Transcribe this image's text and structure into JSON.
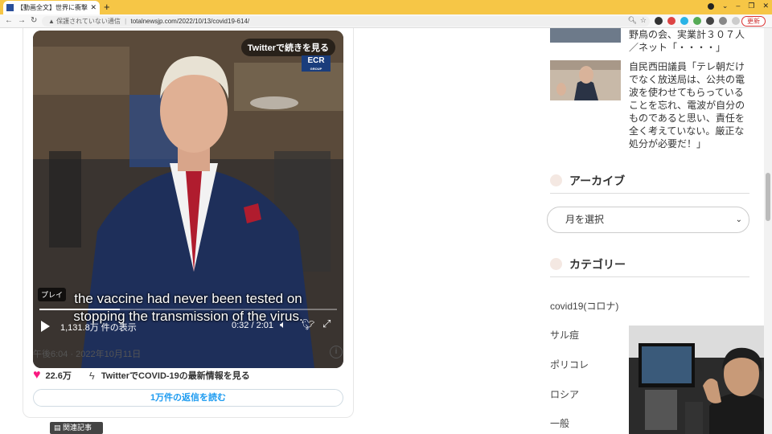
{
  "browser": {
    "tab_title": "【動画全文】世界に衝撃走る！／欧",
    "new_tab": "+",
    "address_warning": "保護されていない通信",
    "url": "totalnewsjp.com/2022/10/13/covid19-614/",
    "update_label": "更新"
  },
  "tweet": {
    "twitter_more": "Twitterで続きを見る",
    "ecr_logo": "ECR",
    "ecr_logo_sub": "GROUP",
    "badge_play": "プレイ",
    "subtitle_line1": "the vaccine had never been tested on",
    "subtitle_line2": "stopping the transmission of the virus.",
    "views": "1,131.8万 件の表示",
    "time": "0:32 / 2:01",
    "progress": 0.27,
    "timestamp": "午後6:04 · 2022年10月11日",
    "likes": "22.6万",
    "latest_info": "TwitterでCOVID-19の最新情報を見る",
    "replies": "1万件の返信を読む"
  },
  "related_label": "関連記事",
  "sidebar": {
    "article1_text": "野鳥の会、実業計３０７人／ネット「・・・・」",
    "article2_text": "自民西田議員「テレ朝だけでなく放送局は、公共の電波を使わせてもらっていることを忘れ、電波が自分のものであると思い、責任を全く考えていない。厳正な処分が必要だ！」",
    "archive_heading": "アーカイブ",
    "archive_select": "月を選択",
    "category_heading": "カテゴリー",
    "categories": [
      "covid19(コロナ)",
      "サル痘",
      "ポリコレ",
      "ロシア",
      "一般"
    ]
  },
  "colors": {
    "tabbar": "#f6c646",
    "twitter_blue": "#1d9bf0",
    "like": "#f91880"
  }
}
